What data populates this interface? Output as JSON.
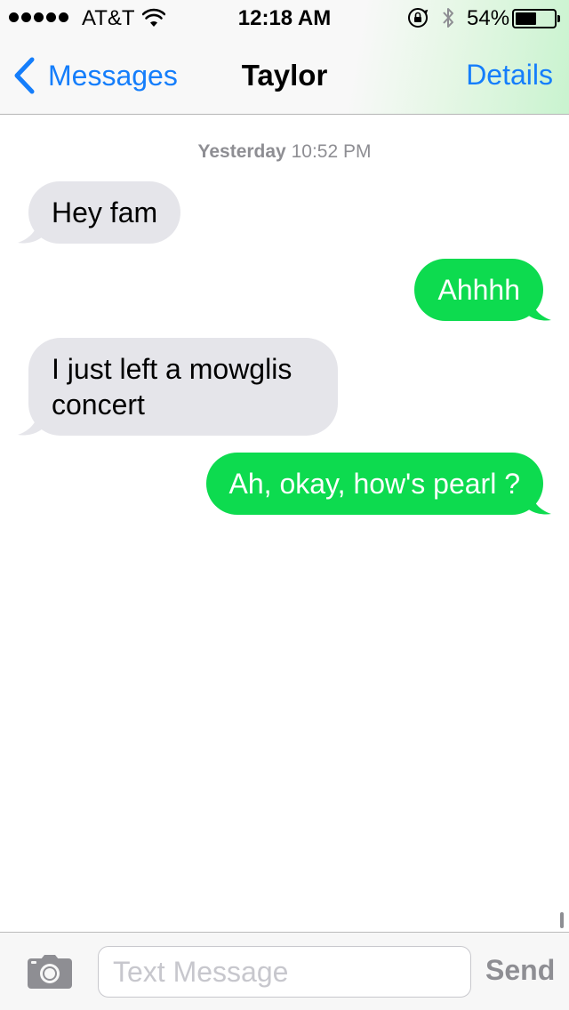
{
  "status_bar": {
    "carrier": "AT&T",
    "time": "12:18 AM",
    "battery_percent": "54%",
    "battery_level": 0.54,
    "icons": [
      "signal-icon",
      "wifi-icon",
      "orientation-lock-icon",
      "bluetooth-icon",
      "battery-icon"
    ]
  },
  "nav": {
    "back_label": "Messages",
    "title": "Taylor",
    "details_label": "Details"
  },
  "conversation": {
    "timestamp_day": "Yesterday",
    "timestamp_time": "10:52 PM",
    "messages": [
      {
        "direction": "incoming",
        "text": "Hey fam"
      },
      {
        "direction": "outgoing",
        "text": "Ahhhh"
      },
      {
        "direction": "incoming",
        "text": "I just left a mowglis concert"
      },
      {
        "direction": "outgoing",
        "text": "Ah, okay, how's pearl ?"
      }
    ]
  },
  "input_bar": {
    "placeholder": "Text Message",
    "value": "",
    "send_label": "Send"
  },
  "colors": {
    "accent_blue": "#157efb",
    "sent_bubble": "#0ddb4f",
    "received_bubble": "#e5e5ea",
    "muted_gray": "#8e8e93"
  }
}
